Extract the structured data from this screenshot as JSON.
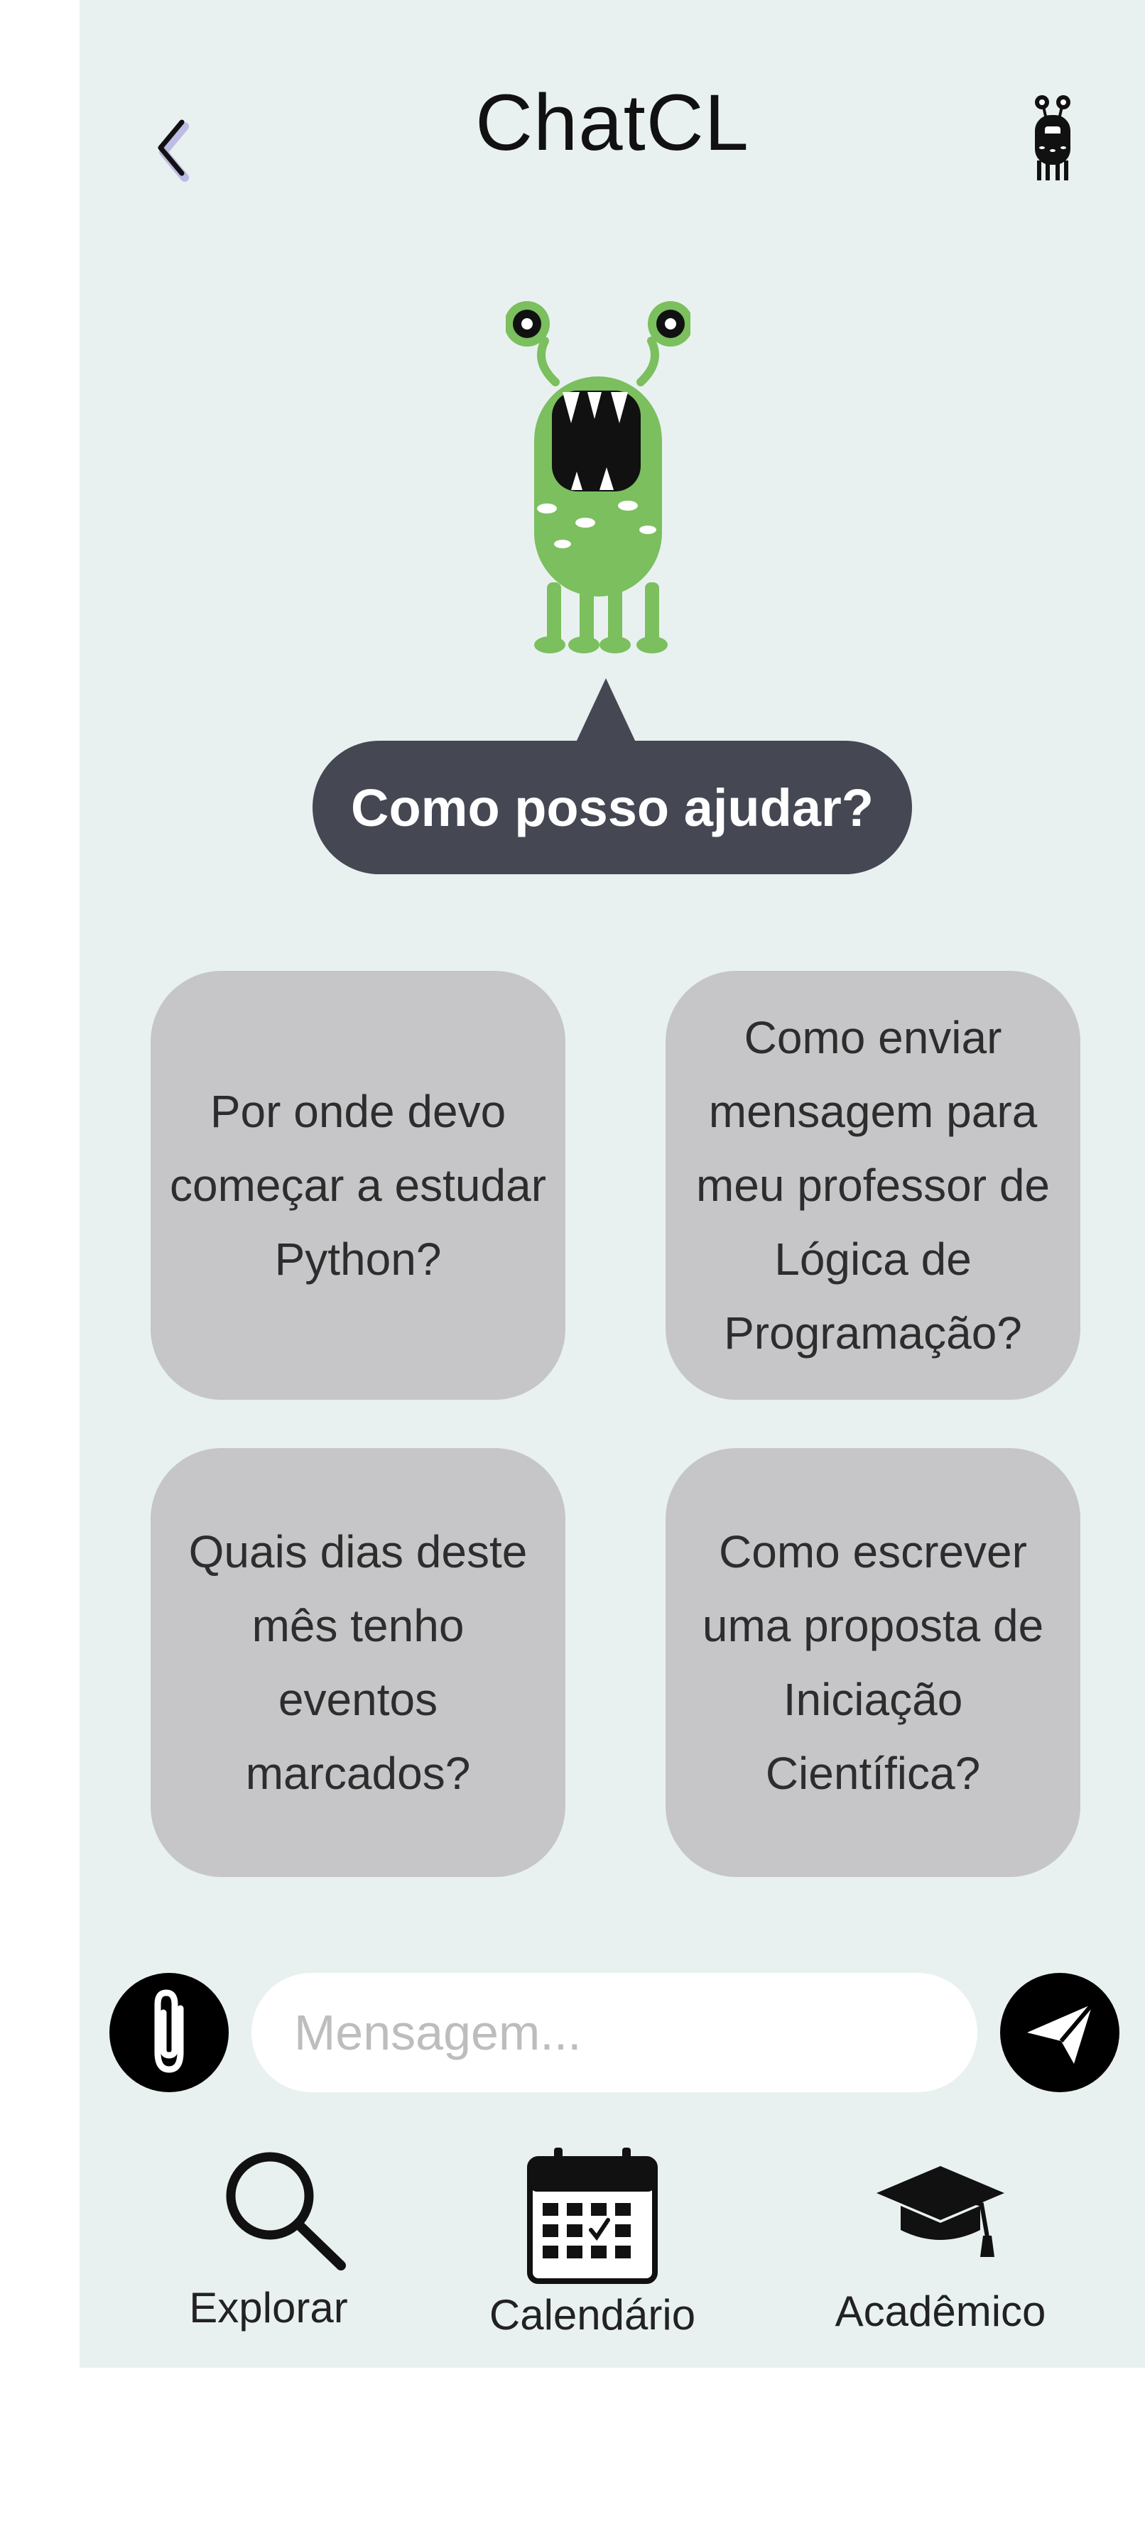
{
  "header": {
    "title": "ChatCL"
  },
  "greeting": "Como posso ajudar?",
  "suggestions": [
    "Por onde devo começar a estudar Python?",
    "Como enviar mensagem para meu professor de Lógica de Programação?",
    "Quais dias deste mês tenho eventos marcados?",
    "Como escrever uma proposta de Iniciação Científica?"
  ],
  "composer": {
    "placeholder": "Mensagem...",
    "attach_icon": "paperclip-icon",
    "send_icon": "paper-plane-icon"
  },
  "bottom_nav": {
    "items": [
      {
        "label": "Explorar",
        "icon": "search-icon"
      },
      {
        "label": "Calendário",
        "icon": "calendar-icon"
      },
      {
        "label": "Acadêmico",
        "icon": "graduation-cap-icon"
      }
    ]
  },
  "colors": {
    "screen_background": "#e9f1f0",
    "bubble": "#454853",
    "card": "#c6c6c8",
    "mascot_green": "#7bbf5e"
  }
}
